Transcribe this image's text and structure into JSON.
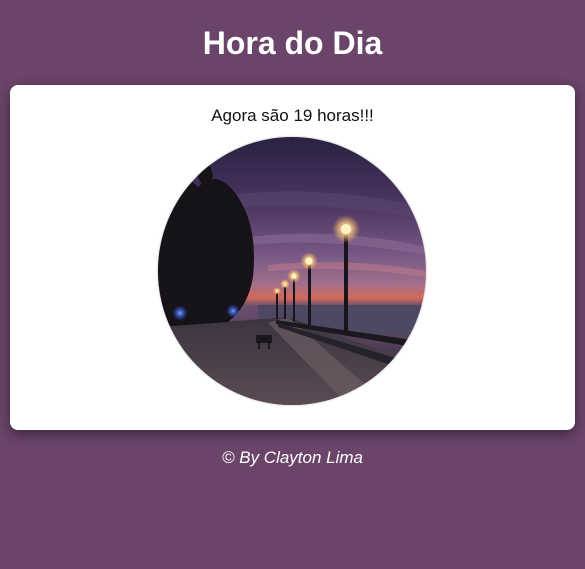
{
  "header": {
    "title": "Hora do Dia"
  },
  "card": {
    "message": "Agora são 19 horas!!!",
    "image": {
      "description_icon": "evening-promenade-photo"
    }
  },
  "footer": {
    "credit": "© By Clayton Lima"
  },
  "colors": {
    "background": "#6b4469",
    "card": "#ffffff",
    "title_text": "#ffffff",
    "message_text": "#111111"
  }
}
